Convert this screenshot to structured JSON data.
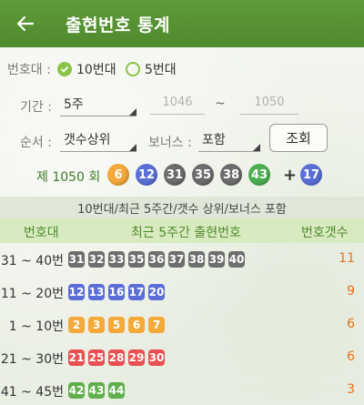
{
  "header": {
    "title": "출현번호 통계"
  },
  "filters": {
    "number_band_label": "번호대 :",
    "options": [
      {
        "label": "10번대",
        "checked": true
      },
      {
        "label": "5번대",
        "checked": false
      }
    ],
    "period_label": "기간 :",
    "period_value": "5주",
    "from_draw": "1046",
    "tilde": "~",
    "to_draw": "1050",
    "order_label": "순서 :",
    "order_value": "갯수상위",
    "bonus_label": "보너스 :",
    "bonus_value": "포함",
    "search_button": "조회"
  },
  "latest_draw": {
    "label": "제 1050 회",
    "numbers": [
      "6",
      "12",
      "31",
      "35",
      "38",
      "43"
    ],
    "plus": "+",
    "bonus": "17",
    "colors": [
      "#f4a93a",
      "#5a6fd8",
      "#6c6c6c",
      "#6c6c6c",
      "#6c6c6c",
      "#4caf50"
    ],
    "bonus_color": "#5a6fd8"
  },
  "summary": "10번대/최근 5주간/갯수 상위/보너스 포함",
  "table": {
    "headers": [
      "번호대",
      "최근 5주간 출현번호",
      "번호갯수"
    ],
    "rows": [
      {
        "range": "31 ~ 40번",
        "numbers": [
          "31",
          "32",
          "33",
          "35",
          "36",
          "37",
          "38",
          "39",
          "40"
        ],
        "count": "11",
        "color": "#6e6e6e"
      },
      {
        "range": "11 ~ 20번",
        "numbers": [
          "12",
          "13",
          "16",
          "17",
          "20"
        ],
        "count": "9",
        "color": "#5b6ed8"
      },
      {
        "range": "1 ~ 10번",
        "numbers": [
          "2",
          "3",
          "5",
          "6",
          "7"
        ],
        "count": "6",
        "color": "#f4a93a"
      },
      {
        "range": "21 ~ 30번",
        "numbers": [
          "21",
          "25",
          "28",
          "29",
          "30"
        ],
        "count": "6",
        "color": "#e85050"
      },
      {
        "range": "41 ~ 45번",
        "numbers": [
          "42",
          "43",
          "44"
        ],
        "count": "3",
        "color": "#5fb04d"
      }
    ]
  }
}
